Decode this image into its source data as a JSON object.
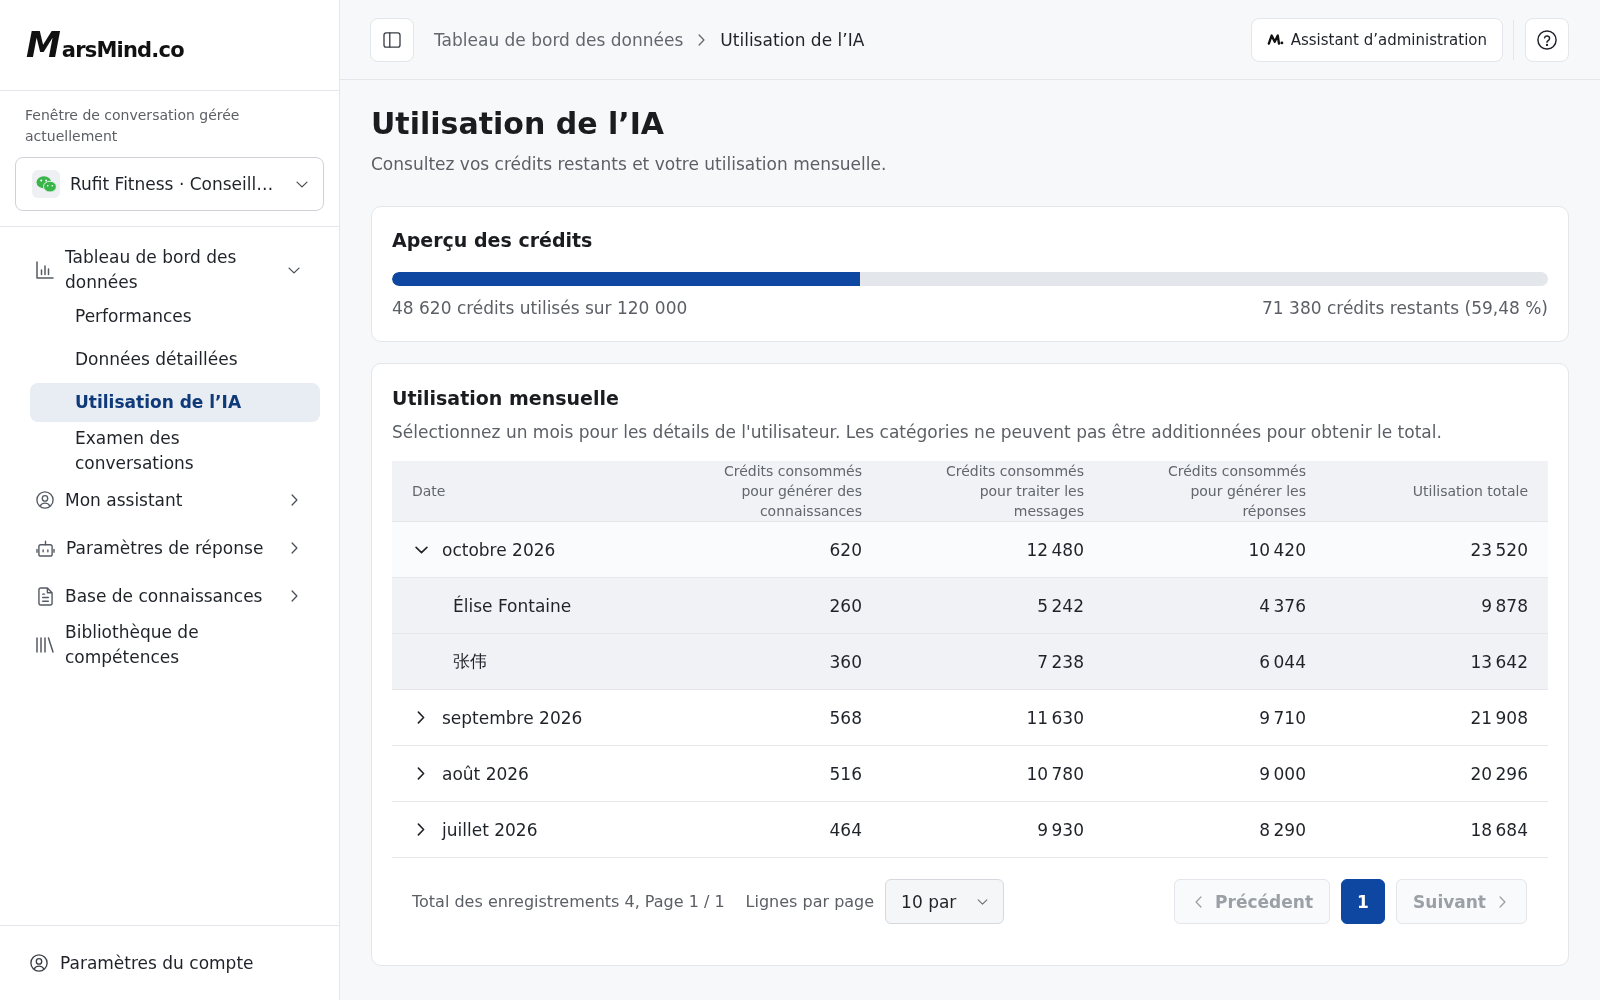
{
  "sidebar": {
    "logo": "MarsMind.co",
    "channel_label": "Fenêtre de conversation gérée actuellement",
    "channel_select": {
      "value": "Rufit Fitness · Conseill…"
    },
    "nav": [
      {
        "kind": "group",
        "label": "Tableau de bord des données",
        "expanded": true,
        "children": [
          {
            "label": "Performances",
            "selected": false
          },
          {
            "label": "Données détaillées",
            "selected": false
          },
          {
            "label": "Utilisation de l’IA",
            "selected": true
          },
          {
            "label": "Examen des conversations",
            "selected": false
          }
        ]
      },
      {
        "kind": "group",
        "label": "Mon assistant",
        "expanded": false
      },
      {
        "kind": "group",
        "label": "Paramètres de réponse",
        "expanded": false
      },
      {
        "kind": "group",
        "label": "Base de connaissances",
        "expanded": false
      },
      {
        "kind": "link",
        "label": "Bibliothèque de compétences"
      }
    ],
    "account": {
      "label": "Paramètres du compte"
    }
  },
  "topbar": {
    "breadcrumb": [
      "Tableau de bord des données",
      "Utilisation de l’IA"
    ],
    "assistant_button": "Assistant d’administration"
  },
  "page": {
    "title": "Utilisation de l’IA",
    "subtitle": "Consultez vos crédits restants et votre utilisation mensuelle."
  },
  "credits": {
    "title": "Aperçu des crédits",
    "level": 0.405,
    "used": "48 620 crédits utilisés sur 120 000",
    "remaining": "71 380 crédits restants (59,48 %)"
  },
  "monthly": {
    "title": "Utilisation mensuelle",
    "description": "Sélectionnez un mois pour les détails de l'utilisateur. Les catégories ne peuvent pas être additionnées pour obtenir le total.",
    "table": {
      "columns": [
        "Date",
        "Crédits consommés pour générer des connaissances",
        "Crédits consommés pour traiter les messages",
        "Crédits consommés pour générer les réponses",
        "Utilisation totale"
      ],
      "rows": [
        {
          "cells": [
            "octobre 2026",
            "620",
            "12 480",
            "10 420",
            "23 520"
          ],
          "expanded": true,
          "children": [
            {
              "cells": [
                "Élise Fontaine",
                "260",
                "5 242",
                "4 376",
                "9 878"
              ]
            },
            {
              "cells": [
                "张伟",
                "360",
                "7 238",
                "6 044",
                "13 642"
              ]
            }
          ]
        },
        {
          "cells": [
            "septembre 2026",
            "568",
            "11 630",
            "9 710",
            "21 908"
          ],
          "expanded": false
        },
        {
          "cells": [
            "août 2026",
            "516",
            "10 780",
            "9 000",
            "20 296"
          ],
          "expanded": false
        },
        {
          "cells": [
            "juillet 2026",
            "464",
            "9 930",
            "8 290",
            "18 684"
          ],
          "expanded": false
        }
      ]
    },
    "pagination": {
      "summary": "Total des enregistrements 4, Page 1 / 1",
      "rows_per_page_label": "Lignes par page",
      "page_size": "10 par",
      "previous": {
        "label": "Précédent",
        "disabled": true
      },
      "pages": [
        {
          "label": "1",
          "selected": true
        }
      ],
      "next": {
        "label": "Suivant",
        "disabled": true
      }
    }
  }
}
